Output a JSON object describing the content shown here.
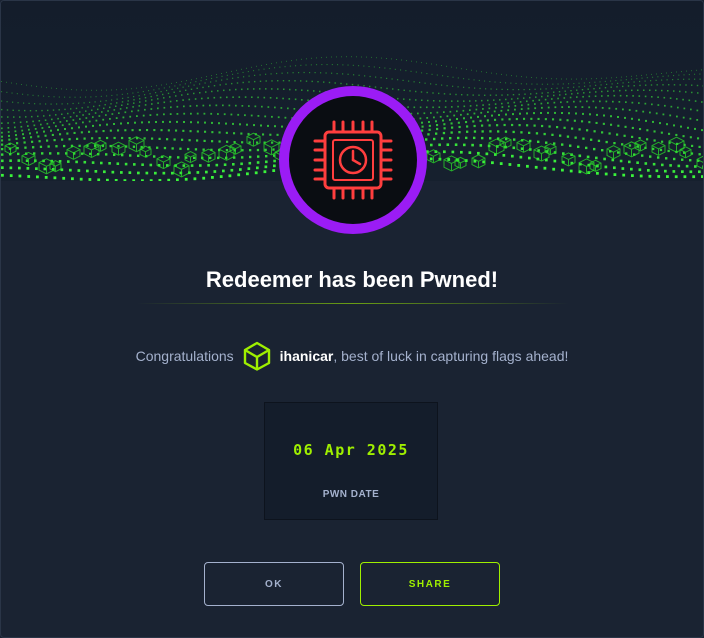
{
  "modal": {
    "title": "Redeemer has been Pwned!",
    "congrats_prefix": "Congratulations",
    "username": "ihanicar",
    "congrats_suffix": ", best of luck in capturing flags ahead!",
    "pwn_date": "06 Apr 2025",
    "pwn_date_label": "PWN DATE",
    "ok_label": "OK",
    "share_label": "SHARE"
  },
  "icons": {
    "banner": "green-voxel-wave-banner",
    "machine": "cpu-clock-icon",
    "rank": "green-cube-icon"
  },
  "colors": {
    "background": "#1a2332",
    "accent_green": "#9fef00",
    "avatar_ring": "#9b1cf5",
    "machine_red": "#ff3e3e",
    "muted_text": "#a4b1cd"
  }
}
